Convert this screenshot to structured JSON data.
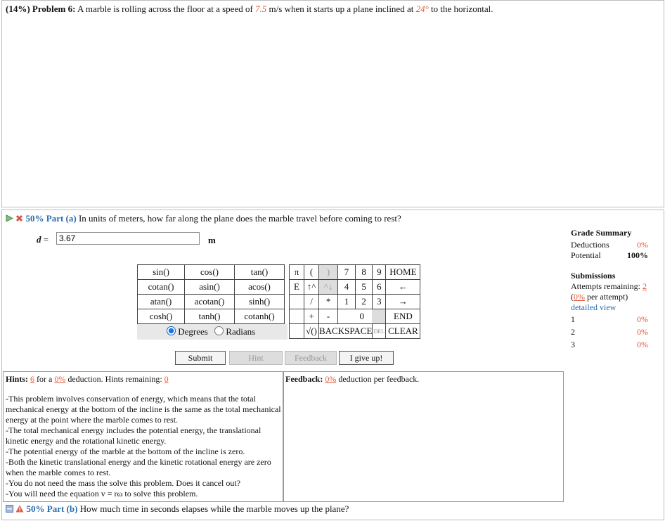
{
  "problem": {
    "pct": "(14%)",
    "label": "Problem 6:",
    "text_a": "A marble is rolling across the floor at a speed of",
    "speed": "7.5",
    "text_b": "m/s when it starts up a plane inclined at",
    "angle": "24°",
    "text_c": "to the horizontal."
  },
  "part_a": {
    "pct": "50% Part (a)",
    "question": "In units of meters, how far along the plane does the marble travel before coming to rest?",
    "var_label": "d =",
    "input_value": "3.67",
    "unit": "m"
  },
  "keypad": {
    "funcs": [
      [
        "sin()",
        "cos()",
        "tan()"
      ],
      [
        "cotan()",
        "asin()",
        "acos()"
      ],
      [
        "atan()",
        "acotan()",
        "sinh()"
      ],
      [
        "cosh()",
        "tanh()",
        "cotanh()"
      ]
    ],
    "row1": [
      "π",
      "(",
      ")",
      "7",
      "8",
      "9",
      "HOME"
    ],
    "row2": [
      "E",
      "↑^",
      "^↓",
      "4",
      "5",
      "6",
      "←"
    ],
    "row3": [
      "",
      "/",
      "*",
      "1",
      "2",
      "3",
      "→"
    ],
    "row4": [
      "",
      "+",
      "-",
      "",
      "0",
      "",
      "END"
    ],
    "row5": [
      "√()",
      "BACKSPACE",
      "DEL",
      "CLEAR"
    ],
    "degrees": "Degrees",
    "radians": "Radians"
  },
  "buttons": {
    "submit": "Submit",
    "hint": "Hint",
    "feedback": "Feedback",
    "give_up": "I give up!"
  },
  "hints": {
    "label": "Hints:",
    "count": "6",
    "for_a": "for a",
    "pct": "0%",
    "deduction": "deduction. Hints remaining:",
    "remaining": "0",
    "lines": [
      "-This problem involves conservation of energy, which means that the total",
      "mechanical energy at the bottom of the incline is the same as the total mechanical",
      "energy at the point where the marble comes to rest.",
      "-The total mechanical energy includes the potential energy, the translational",
      "kinetic energy and the rotational kinetic energy.",
      "-The potential energy of the marble at the bottom of the incline is zero.",
      "-Both the kinetic translational energy and the kinetic rotational energy are zero",
      "when the marble comes to rest.",
      "-You do not need the mass the solve this problem. Does it cancel out?",
      "-You will need the equation v = rω to solve this problem."
    ]
  },
  "feedback": {
    "label": "Feedback:",
    "pct": "0%",
    "text": "deduction per feedback."
  },
  "grade": {
    "title": "Grade Summary",
    "deductions": "Deductions",
    "deductions_val": "0%",
    "potential": "Potential",
    "potential_val": "100%",
    "submissions": "Submissions",
    "attempts": "Attempts remaining:",
    "attempts_val": "2",
    "per_open": "(",
    "per_pct": "0%",
    "per_text": "per attempt)",
    "detailed": "detailed view",
    "rows": [
      [
        "1",
        "0%"
      ],
      [
        "2",
        "0%"
      ],
      [
        "3",
        "0%"
      ]
    ]
  },
  "part_b": {
    "pct": "50% Part (b)",
    "question": "How much time in seconds elapses while the marble moves up the plane?"
  },
  "colors": {
    "accent": "#e15b3a",
    "link": "#2b6cb0",
    "border": "#bdbdbd"
  }
}
